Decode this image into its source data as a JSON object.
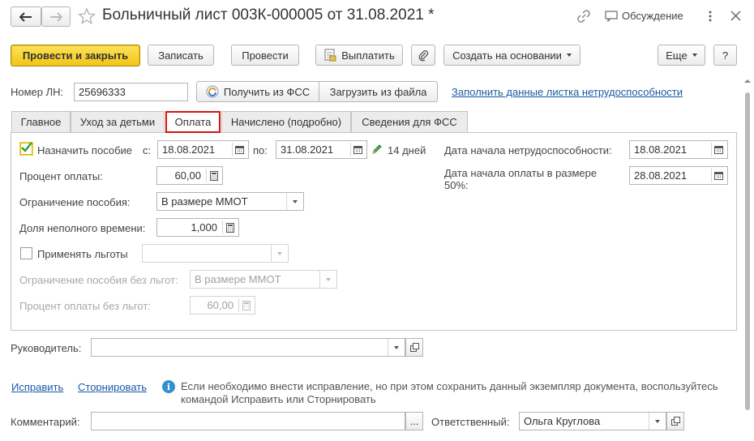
{
  "title": "Больничный лист 003К-000005 от 31.08.2021 *",
  "header": {
    "discussion": "Обсуждение"
  },
  "toolbar": {
    "post_close": "Провести и закрыть",
    "save": "Записать",
    "post": "Провести",
    "pay": "Выплатить",
    "create_based": "Создать на основании",
    "more": "Еще",
    "help": "?"
  },
  "doc": {
    "ln_label": "Номер ЛН:",
    "ln_value": "25696333",
    "get_fss": "Получить из ФСС",
    "load_file": "Загрузить из файла",
    "fill_link": "Заполнить данные листка нетрудоспособности"
  },
  "tabs": [
    {
      "label": "Главное"
    },
    {
      "label": "Уход за детьми"
    },
    {
      "label": "Оплата"
    },
    {
      "label": "Начислено (подробно)"
    },
    {
      "label": "Сведения для ФСС"
    }
  ],
  "payment": {
    "assign_label": "Назначить пособие",
    "from_label": "с:",
    "from_value": "18.08.2021",
    "to_label": "по:",
    "to_value": "31.08.2021",
    "days": "14 дней",
    "percent_label": "Процент оплаты:",
    "percent_value": "60,00",
    "limit_label": "Ограничение пособия:",
    "limit_value": "В размере ММОТ",
    "part_time_label": "Доля неполного времени:",
    "part_time_value": "1,000",
    "benefits_label": "Применять льготы",
    "benefits_value": "",
    "limit_wo_label": "Ограничение пособия без льгот:",
    "limit_wo_value": "В размере ММОТ",
    "percent_wo_label": "Процент оплаты без льгот:",
    "percent_wo_value": "60,00",
    "disability_start_label": "Дата начала нетрудоспособности:",
    "disability_start_value": "18.08.2021",
    "pay50_label_1": "Дата начала оплаты в размере",
    "pay50_label_2": "50%:",
    "pay50_value": "28.08.2021"
  },
  "footer": {
    "manager_label": "Руководитель:",
    "manager_value": "",
    "fix_link": "Исправить",
    "storno_link": "Сторнировать",
    "info_line1": "Если необходимо внести исправление, но при этом сохранить данный экземпляр документа, воспользуйтесь",
    "info_line2": "командой Исправить или Сторнировать",
    "comment_label": "Комментарий:",
    "comment_value": "",
    "comment_more": "...",
    "responsible_label": "Ответственный:",
    "responsible_value": "Ольга Круглова"
  },
  "colors": {
    "accent": "#f2c517",
    "active_tab_border": "#dd1111",
    "link": "#1a5aa5",
    "check": "#2e9d2e",
    "info": "#3390cc"
  }
}
